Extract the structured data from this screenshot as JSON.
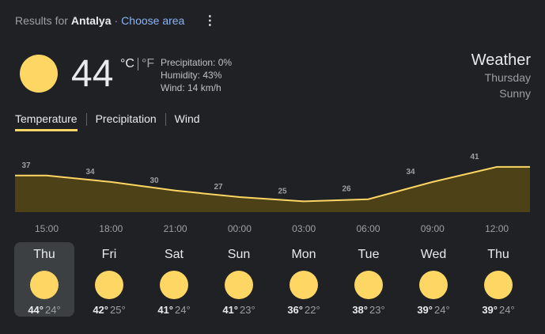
{
  "header": {
    "results_for": "Results for",
    "location": "Antalya",
    "separator": "·",
    "choose_area": "Choose area"
  },
  "current": {
    "temperature": "44",
    "unit_c": "°C",
    "unit_f": "°F",
    "precipitation": "Precipitation: 0%",
    "humidity": "Humidity: 43%",
    "wind": "Wind: 14 km/h",
    "icon": "sun-icon"
  },
  "summary": {
    "title": "Weather",
    "day": "Thursday",
    "condition": "Sunny"
  },
  "tabs": [
    {
      "label": "Temperature",
      "active": true
    },
    {
      "label": "Precipitation",
      "active": false
    },
    {
      "label": "Wind",
      "active": false
    }
  ],
  "chart_data": {
    "type": "area",
    "x": [
      "15:00",
      "18:00",
      "21:00",
      "00:00",
      "03:00",
      "06:00",
      "09:00",
      "12:00"
    ],
    "series": [
      {
        "values": [
          37,
          34,
          30,
          27,
          25,
          26,
          34,
          41
        ]
      }
    ],
    "labels": [
      "37",
      "34",
      "30",
      "27",
      "25",
      "26",
      "34",
      "41"
    ],
    "ylim": [
      20,
      45
    ],
    "line_color": "#fdd663",
    "fill_color": "#4d4118"
  },
  "forecast": [
    {
      "day": "Thu",
      "high": "44°",
      "low": "24°",
      "selected": true
    },
    {
      "day": "Fri",
      "high": "42°",
      "low": "25°",
      "selected": false
    },
    {
      "day": "Sat",
      "high": "41°",
      "low": "24°",
      "selected": false
    },
    {
      "day": "Sun",
      "high": "41°",
      "low": "23°",
      "selected": false
    },
    {
      "day": "Mon",
      "high": "36°",
      "low": "22°",
      "selected": false
    },
    {
      "day": "Tue",
      "high": "38°",
      "low": "23°",
      "selected": false
    },
    {
      "day": "Wed",
      "high": "39°",
      "low": "24°",
      "selected": false
    },
    {
      "day": "Thu",
      "high": "39°",
      "low": "24°",
      "selected": false
    }
  ]
}
